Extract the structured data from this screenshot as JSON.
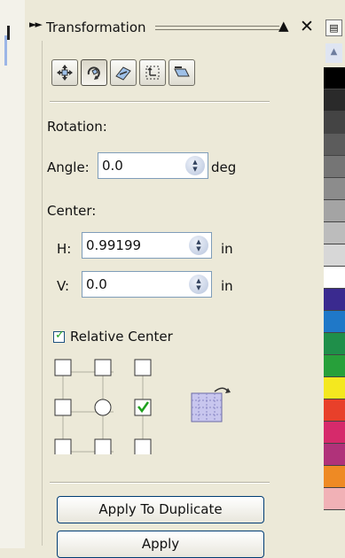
{
  "panel": {
    "title": "Transformation",
    "rotation": {
      "heading": "Rotation:",
      "angle_label": "Angle:",
      "angle_value": "0.0",
      "angle_unit": "deg",
      "center_label": "Center:",
      "h_label": "H:",
      "h_value": "0.99199",
      "h_unit": "in",
      "v_label": "V:",
      "v_value": "0.0",
      "v_unit": "in"
    },
    "relative_center": {
      "label": "Relative Center",
      "checked": true,
      "selected_anchor": "middle-right"
    },
    "buttons": {
      "apply_to_duplicate": "Apply To Duplicate",
      "apply": "Apply"
    },
    "toolbar_icons": [
      "position-icon",
      "rotation-icon",
      "scale-icon",
      "size-icon",
      "skew-icon"
    ]
  },
  "palette": {
    "swatches": [
      "#000000",
      "#2a2a2a",
      "#444444",
      "#5c5c5c",
      "#757575",
      "#8c8c8c",
      "#a4a4a4",
      "#bcbcbc",
      "#d7d7d7",
      "#ffffff",
      "#3a2a8f",
      "#1f78c8",
      "#1f8f4a",
      "#27a03a",
      "#f4e81f",
      "#e8402a",
      "#d62a6b",
      "#b0327a",
      "#ee8a24",
      "#f1b1b6"
    ]
  }
}
